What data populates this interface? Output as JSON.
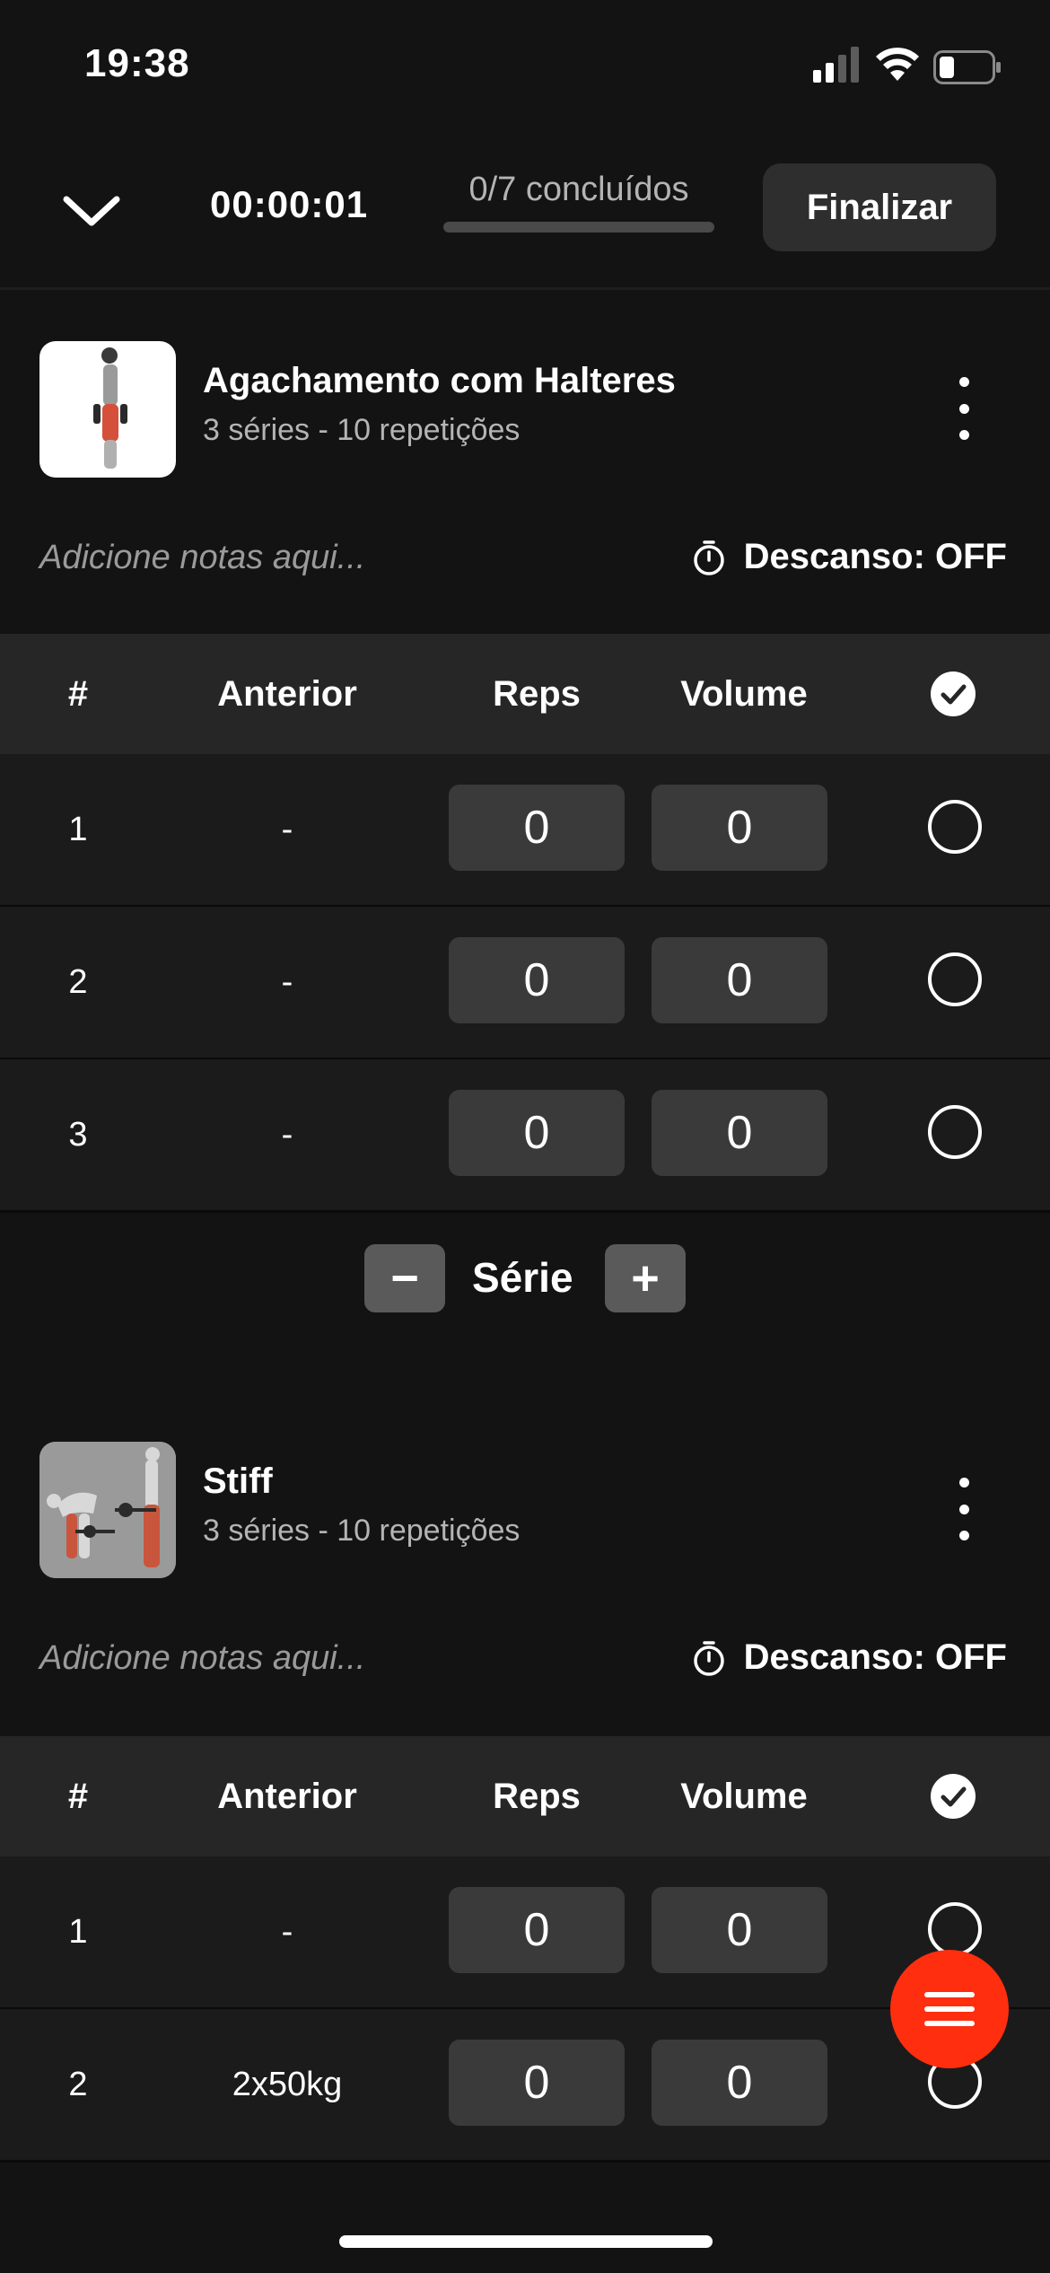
{
  "status_bar": {
    "time": "19:38"
  },
  "header": {
    "timer": "00:00:01",
    "progress_label": "0/7 concluídos",
    "progress_fraction": 0,
    "finish_label": "Finalizar"
  },
  "table_headers": {
    "num": "#",
    "previous": "Anterior",
    "reps": "Reps",
    "volume": "Volume"
  },
  "exercises": [
    {
      "name": "Agachamento com Halteres",
      "subtitle": "3 séries - 10 repetições",
      "notes_placeholder": "Adicione notas aqui...",
      "rest": "Descanso: OFF",
      "sets": [
        {
          "num": "1",
          "previous": "-",
          "reps": "0",
          "volume": "0"
        },
        {
          "num": "2",
          "previous": "-",
          "reps": "0",
          "volume": "0"
        },
        {
          "num": "3",
          "previous": "-",
          "reps": "0",
          "volume": "0"
        }
      ]
    },
    {
      "name": "Stiff",
      "subtitle": "3 séries - 10 repetições",
      "notes_placeholder": "Adicione notas aqui...",
      "rest": "Descanso: OFF",
      "sets": [
        {
          "num": "1",
          "previous": "-",
          "reps": "0",
          "volume": "0"
        },
        {
          "num": "2",
          "previous": "2x50kg",
          "reps": "0",
          "volume": "0"
        }
      ]
    }
  ],
  "series_control": {
    "label": "Série",
    "minus": "−",
    "plus": "+"
  },
  "colors": {
    "background": "#131313",
    "accent": "#ff2e0f",
    "row": "#1b1b1b",
    "header_row": "#262626"
  }
}
